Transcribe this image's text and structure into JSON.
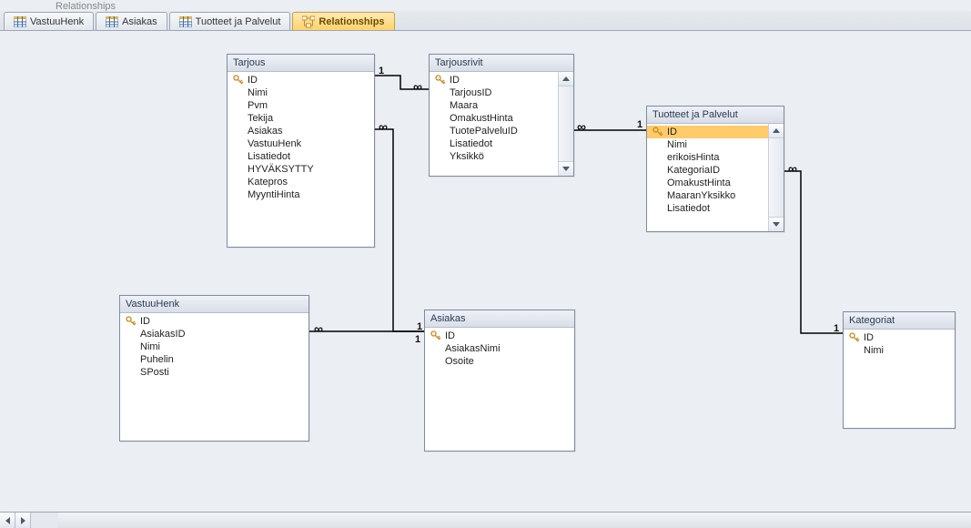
{
  "remnant_text": "Relationships",
  "tabs": [
    {
      "label": "VastuuHenk",
      "type": "table",
      "active": false
    },
    {
      "label": "Asiakas",
      "type": "table",
      "active": false
    },
    {
      "label": "Tuotteet ja Palvelut",
      "type": "table",
      "active": false
    },
    {
      "label": "Relationships",
      "type": "relationship",
      "active": true
    }
  ],
  "tables": {
    "tarjous": {
      "title": "Tarjous",
      "fields": [
        "ID",
        "Nimi",
        "Pvm",
        "Tekija",
        "Asiakas",
        "VastuuHenk",
        "Lisatiedot",
        "HYVÄKSYTTY",
        "Katepros",
        "MyyntiHinta"
      ],
      "pk_index": 0,
      "scroll": false,
      "selected_index": -1
    },
    "tarjousrivit": {
      "title": "Tarjousrivit",
      "fields": [
        "ID",
        "TarjousID",
        "Maara",
        "OmakustHinta",
        "TuotePalveluID",
        "Lisatiedot",
        "Yksikkö"
      ],
      "pk_index": 0,
      "scroll": true,
      "selected_index": -1
    },
    "tuotteet": {
      "title": "Tuotteet ja Palvelut",
      "fields": [
        "ID",
        "Nimi",
        "erikoisHinta",
        "KategoriaID",
        "OmakustHinta",
        "MaaranYksikko",
        "Lisatiedot"
      ],
      "pk_index": 0,
      "scroll": true,
      "selected_index": 0
    },
    "vastuuhenk": {
      "title": "VastuuHenk",
      "fields": [
        "ID",
        "AsiakasID",
        "Nimi",
        "Puhelin",
        "SPosti"
      ],
      "pk_index": 0,
      "scroll": false,
      "selected_index": -1
    },
    "asiakas": {
      "title": "Asiakas",
      "fields": [
        "ID",
        "AsiakasNimi",
        "Osoite"
      ],
      "pk_index": 0,
      "scroll": false,
      "selected_index": -1
    },
    "kategoriat": {
      "title": "Kategoriat",
      "fields": [
        "ID",
        "Nimi"
      ],
      "pk_index": 0,
      "scroll": false,
      "selected_index": -1
    }
  },
  "relationships": [
    {
      "from_table": "tarjous",
      "from_field": "ID",
      "to_table": "tarjousrivit",
      "to_field": "TarjousID",
      "cardinality": "1-inf"
    },
    {
      "from_table": "tuotteet",
      "from_field": "ID",
      "to_table": "tarjousrivit",
      "to_field": "TuotePalveluID",
      "cardinality": "1-inf"
    },
    {
      "from_table": "asiakas",
      "from_field": "ID",
      "to_table": "tarjous",
      "to_field": "Asiakas",
      "cardinality": "1-inf"
    },
    {
      "from_table": "asiakas",
      "from_field": "ID",
      "to_table": "vastuuhenk",
      "to_field": "AsiakasID",
      "cardinality": "1-inf"
    },
    {
      "from_table": "kategoriat",
      "from_field": "ID",
      "to_table": "tuotteet",
      "to_field": "KategoriaID",
      "cardinality": "1-inf"
    }
  ]
}
